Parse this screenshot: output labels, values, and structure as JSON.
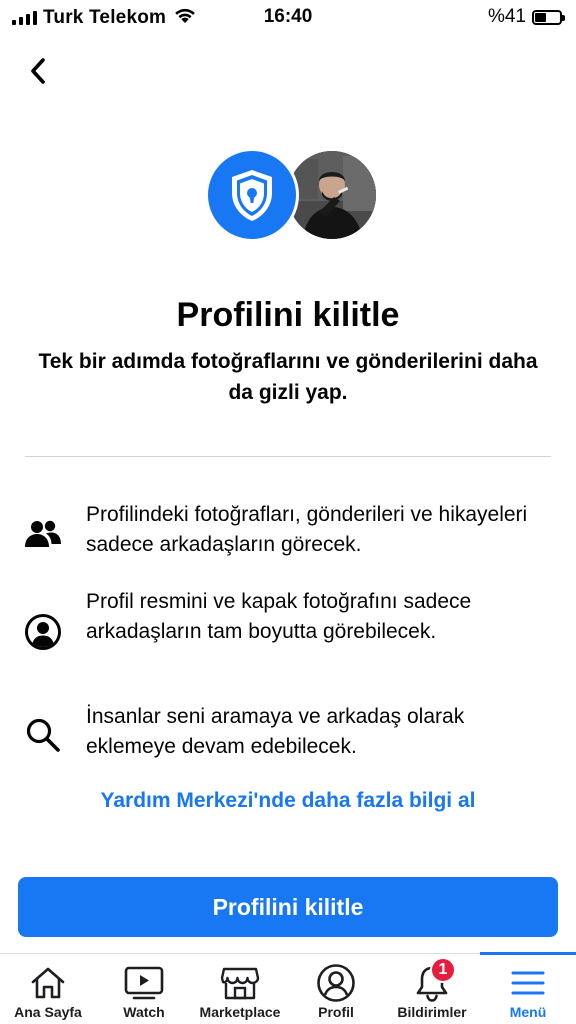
{
  "status_bar": {
    "carrier": "Turk Telekom",
    "time": "16:40",
    "battery_percent": "%41",
    "battery_level": 0.41
  },
  "header": {
    "back_icon": "chevron-left-icon"
  },
  "hero": {
    "shield_icon": "shield-lock-icon"
  },
  "title": "Profilini kilitle",
  "subtitle": "Tek bir adımda fotoğraflarını ve gönderilerini daha da gizli yap.",
  "features": [
    {
      "icon": "friends-icon",
      "text": "Profilindeki fotoğrafları, gönderileri ve hikayeleri sadece arkadaşların görecek."
    },
    {
      "icon": "profile-circle-icon",
      "text": "Profil resmini ve kapak fotoğrafını sadece arkadaşların tam boyutta görebilecek."
    },
    {
      "icon": "search-icon",
      "text": "İnsanlar seni aramaya ve arkadaş olarak eklemeye devam edebilecek."
    }
  ],
  "help_link": "Yardım Merkezi'nde daha fazla bilgi al",
  "primary_button": "Profilini kilitle",
  "tabs": [
    {
      "label": "Ana Sayfa",
      "icon": "home-icon"
    },
    {
      "label": "Watch",
      "icon": "watch-icon"
    },
    {
      "label": "Marketplace",
      "icon": "marketplace-icon"
    },
    {
      "label": "Profil",
      "icon": "profile-icon"
    },
    {
      "label": "Bildirimler",
      "icon": "bell-icon",
      "badge": "1"
    },
    {
      "label": "Menü",
      "icon": "menu-icon",
      "active": true
    }
  ],
  "colors": {
    "accent": "#1877f2",
    "badge": "#e41e3f",
    "text": "#050505"
  }
}
